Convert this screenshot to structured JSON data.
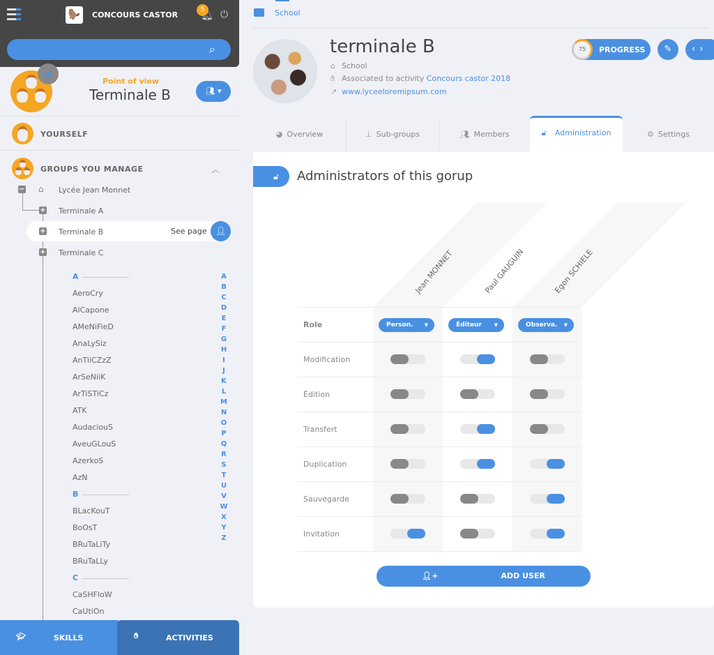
{
  "app": {
    "title": "CONCOURS CASTOR",
    "notifications": "5"
  },
  "search": {
    "placeholder": ""
  },
  "point_of_view": {
    "label": "Point of view",
    "name": "Terminale B"
  },
  "sidebar": {
    "yourself": "YOURSELF",
    "groups_title": "GROUPS YOU MANAGE",
    "tree": {
      "root": "Lycée Jean Monnet",
      "children": [
        "Terminale A",
        "Terminale B",
        "Terminale C"
      ]
    },
    "see_page": "See page",
    "letter_groups": [
      {
        "letter": "A",
        "names": [
          "AeroCry",
          "AlCapone",
          "AMeNiFieD",
          "AnaLySiz",
          "AnTiiCZzZ",
          "ArSeNiiK",
          "ArTiSTiCz",
          "ATK",
          "AudaciouS",
          "AveuGLouS",
          "AzerkoS",
          "AzN"
        ]
      },
      {
        "letter": "B",
        "names": [
          "BLacKouT",
          "BoOsT",
          "BRuTaLiTy",
          "BRuTaLLy"
        ]
      },
      {
        "letter": "C",
        "names": [
          "CaSHFloW",
          "CaUtiOn"
        ]
      }
    ],
    "alphabet": [
      "A",
      "B",
      "C",
      "D",
      "E",
      "F",
      "G",
      "H",
      "I",
      "J",
      "K",
      "L",
      "M",
      "N",
      "O",
      "P",
      "Q",
      "R",
      "S",
      "T",
      "U",
      "V",
      "W",
      "X",
      "Y",
      "Z"
    ],
    "bottom_tabs": {
      "skills": "SKILLS",
      "activities": "ACTIVITIES"
    }
  },
  "breadcrumb": "School",
  "group": {
    "title": "terminale B",
    "type": "School",
    "activity_prefix": "Associated to activity",
    "activity": "Concours castor 2018",
    "website": "www.lyceeloremipsum.com"
  },
  "progress": {
    "value": 75,
    "label": "PROGRESS"
  },
  "tabs": [
    "Overview",
    "Sub-groups",
    "Members",
    "Administration",
    "Settings"
  ],
  "admin": {
    "title": "Administrators of this gorup",
    "users": [
      "Jean MONNET",
      "Paul GAUGUIN",
      "Egon SCHIELE"
    ],
    "role_label": "Role",
    "roles": [
      "Person.",
      "Éditeur",
      "Observa."
    ],
    "permissions": [
      {
        "label": "Modification",
        "values": [
          false,
          true,
          false
        ]
      },
      {
        "label": "Édition",
        "values": [
          false,
          false,
          false
        ]
      },
      {
        "label": "Transfert",
        "values": [
          false,
          true,
          false
        ]
      },
      {
        "label": "Duplication",
        "values": [
          false,
          true,
          true
        ]
      },
      {
        "label": "Sauvegarde",
        "values": [
          false,
          false,
          true
        ]
      },
      {
        "label": "Invitation",
        "values": [
          true,
          false,
          true
        ]
      }
    ],
    "add_user": "ADD USER"
  },
  "colors": {
    "accent": "#4a90e2",
    "orange": "#f5a623",
    "dark": "#464646"
  }
}
